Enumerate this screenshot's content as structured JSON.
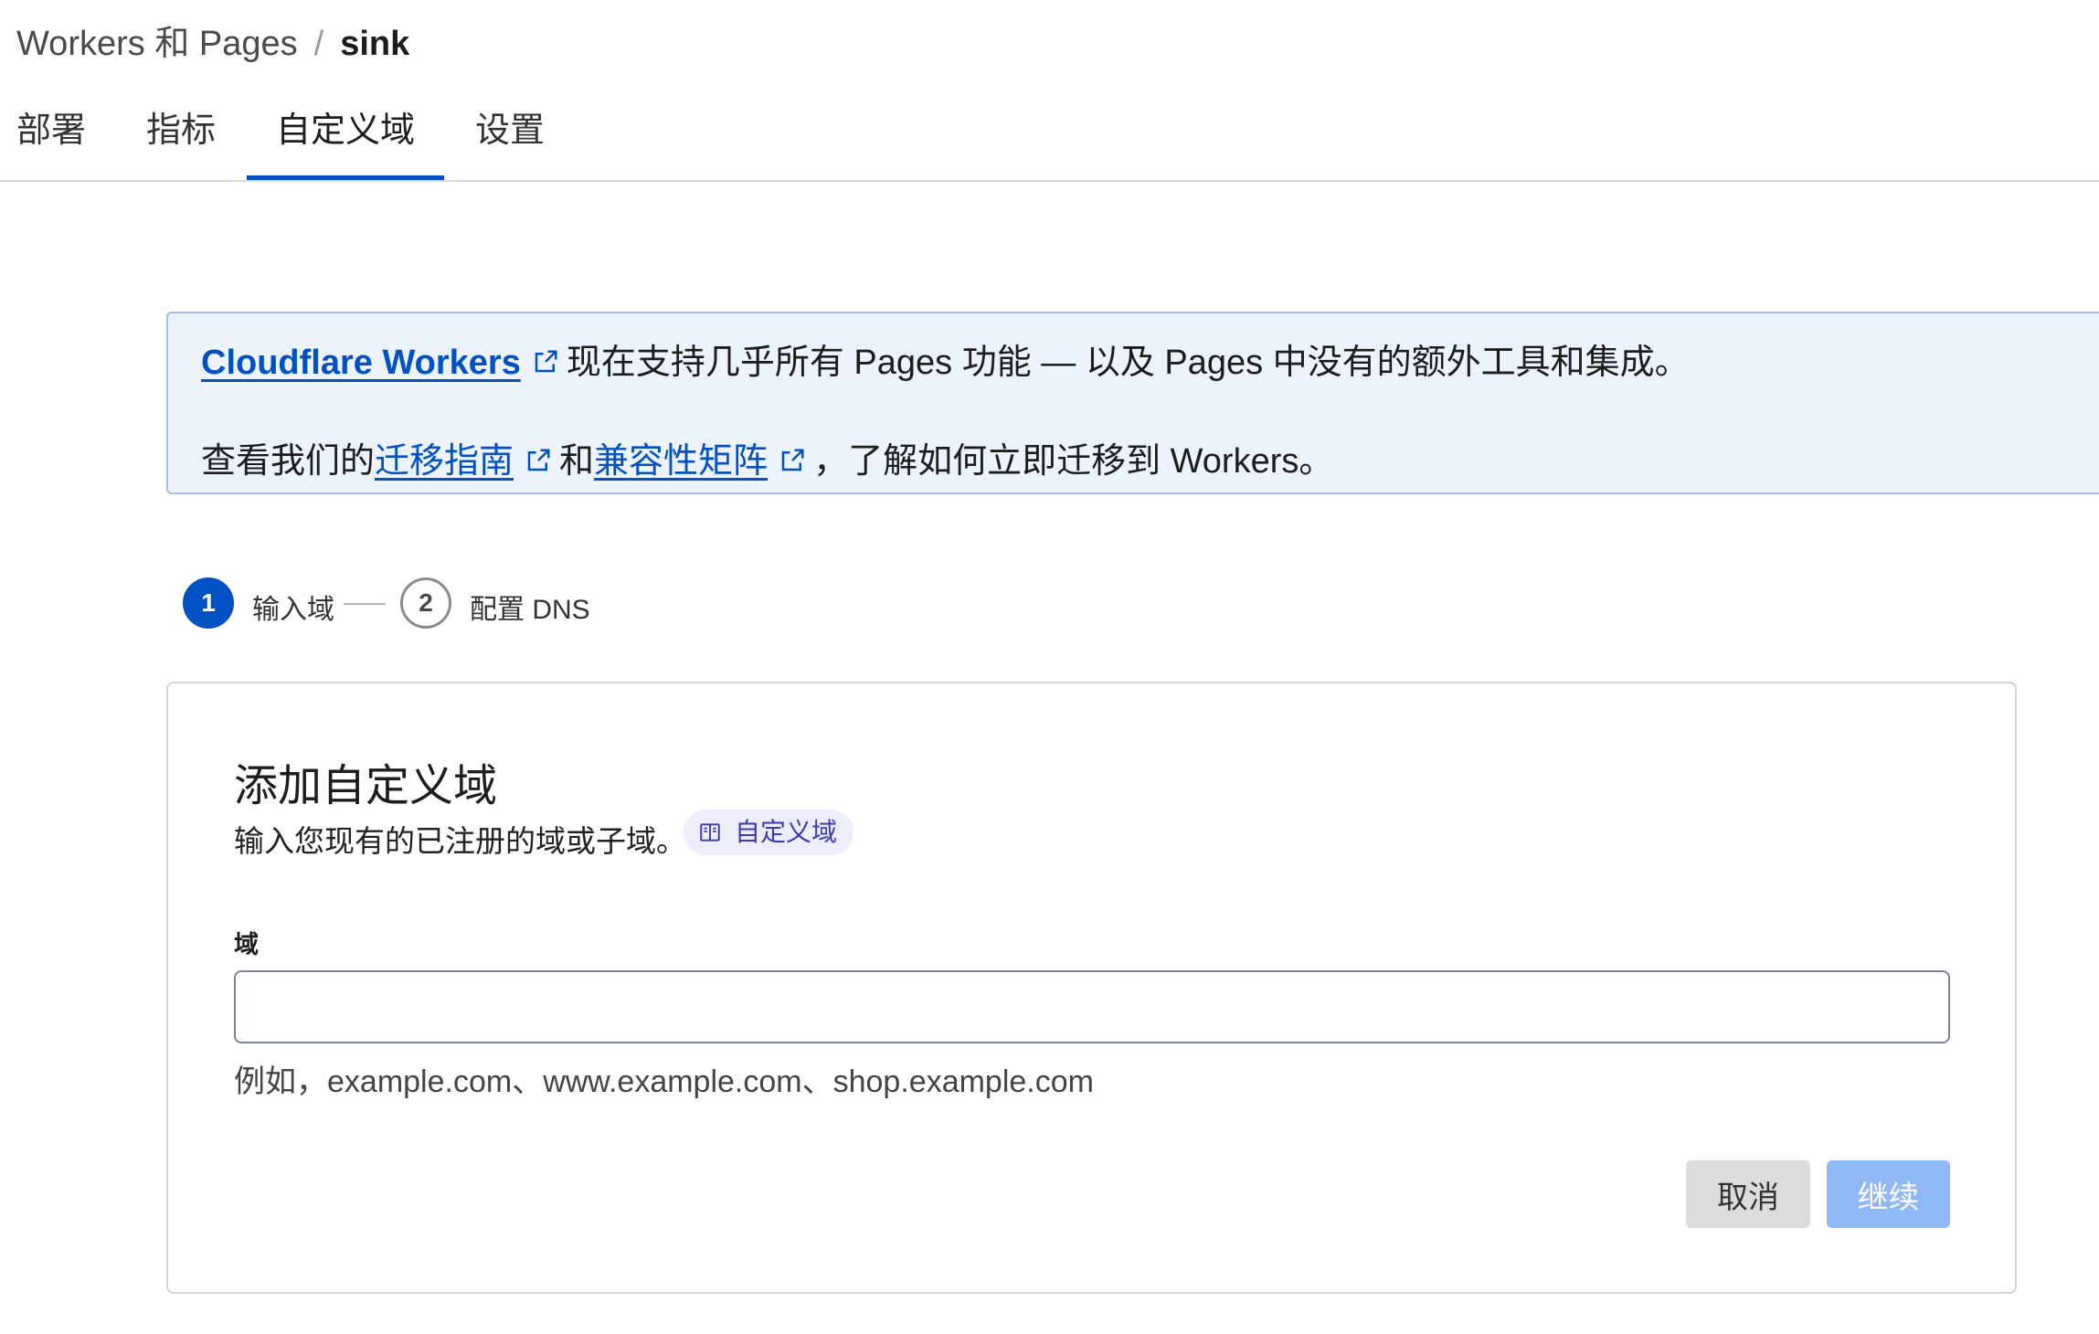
{
  "breadcrumb": {
    "parent": "Workers 和 Pages",
    "separator": "/",
    "current": "sink"
  },
  "tabs": [
    {
      "label": "部署",
      "active": false
    },
    {
      "label": "指标",
      "active": false
    },
    {
      "label": "自定义域",
      "active": true
    },
    {
      "label": "设置",
      "active": false
    }
  ],
  "banner": {
    "link1": "Cloudflare Workers",
    "text1": "现在支持几乎所有 Pages 功能 — 以及 Pages 中没有的额外工具和集成。",
    "text2_prefix": "查看我们的",
    "link2": "迁移指南",
    "text2_mid": "和",
    "link3": "兼容性矩阵",
    "text2_suffix": "，了解如何立即迁移到 Workers。"
  },
  "steps": [
    {
      "number": "1",
      "label": "输入域",
      "active": true
    },
    {
      "number": "2",
      "label": "配置 DNS",
      "active": false
    }
  ],
  "card": {
    "title": "添加自定义域",
    "description": "输入您现有的已注册的域或子域。",
    "doc_link": "自定义域",
    "field_label": "域",
    "field_value": "",
    "field_hint": "例如，example.com、www.example.com、shop.example.com",
    "cancel_label": "取消",
    "continue_label": "继续"
  },
  "colors": {
    "accent": "#0051c3",
    "banner_bg": "#ecf3fd",
    "continue_disabled": "#8fb8f6"
  },
  "icons": {
    "external_link": "external-link-icon",
    "doc": "book-icon"
  }
}
